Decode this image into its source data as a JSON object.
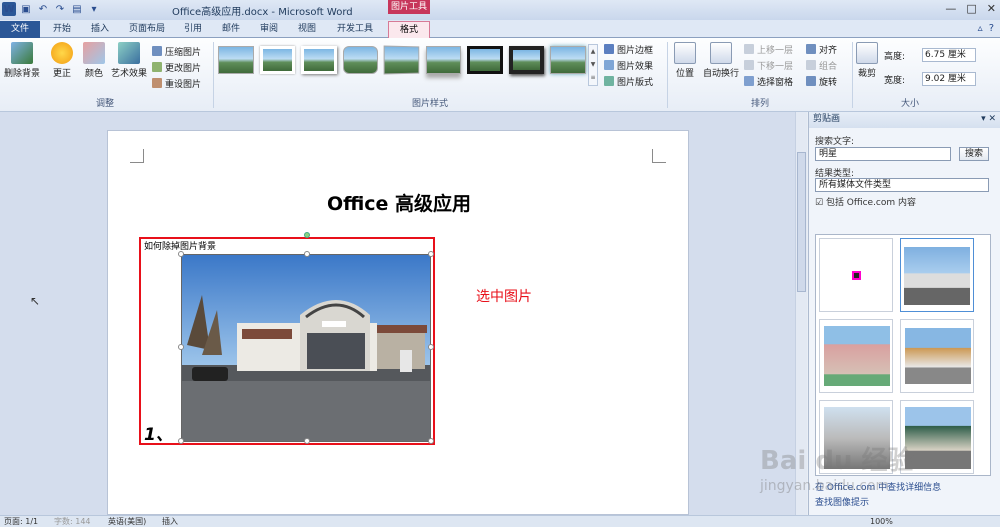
{
  "window": {
    "title": "Office高级应用.docx - Microsoft Word",
    "context_group": "图片工具",
    "controls": [
      "—",
      "□",
      "✕"
    ]
  },
  "tabs": {
    "file": "文件",
    "items": [
      "开始",
      "插入",
      "页面布局",
      "引用",
      "邮件",
      "审阅",
      "视图",
      "开发工具"
    ],
    "context": "格式"
  },
  "ribbon": {
    "adjust": {
      "remove_bg": "删除背景",
      "corrections": "更正",
      "color": "颜色",
      "artistic": "艺术效果",
      "compress": "压缩图片",
      "change": "更改图片",
      "reset": "重设图片",
      "label": "调整"
    },
    "styles": {
      "border": "图片边框",
      "effects": "图片效果",
      "layout": "图片版式",
      "label": "图片样式"
    },
    "arrange": {
      "position": "位置",
      "wrap": "自动换行",
      "bring_forward": "上移一层",
      "send_backward": "下移一层",
      "selection_pane": "选择窗格",
      "align": "对齐",
      "group": "组合",
      "rotate": "旋转",
      "label": "排列"
    },
    "size": {
      "crop": "裁剪",
      "height_label": "高度:",
      "height_value": "6.75 厘米",
      "width_label": "宽度:",
      "width_value": "9.02 厘米",
      "label": "大小"
    }
  },
  "document": {
    "heading": "Office 高级应用",
    "frame_text": "如何除掉图片背景",
    "number": "1、",
    "note": "选中图片"
  },
  "clipart": {
    "title": "剪贴画",
    "search_label": "搜索文字:",
    "search_value": "明星",
    "search_button": "搜索",
    "type_label": "结果类型:",
    "type_value": "所有媒体文件类型",
    "include_label": "包括 Office.com 内容",
    "footer1": "在 Office.com 中查找详细信息",
    "footer2": "查找图像提示"
  },
  "status": {
    "page": "页面: 1/1",
    "words": "字数: 144",
    "lang": "英语(美国)",
    "mode": "插入",
    "zoom": "100%"
  },
  "watermark": {
    "line1": "Bai du 经验",
    "line2": "jingyan.baidu.com"
  }
}
